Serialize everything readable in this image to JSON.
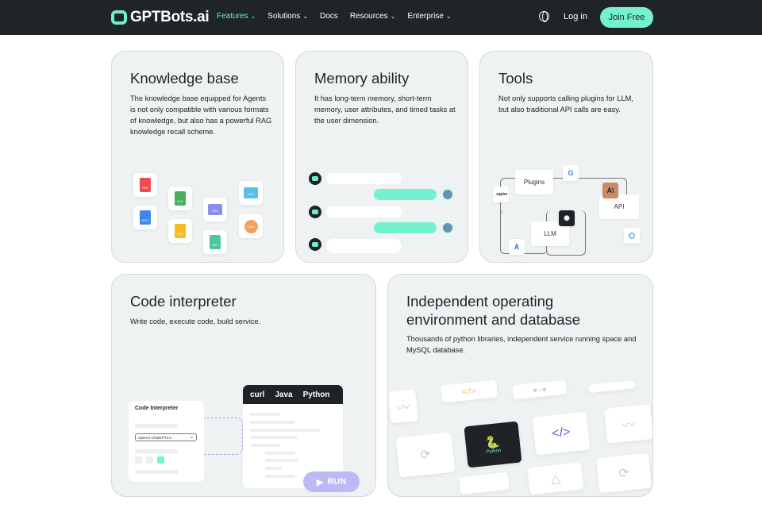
{
  "nav": {
    "brand": "GPTBots.ai",
    "items": [
      "Features",
      "Solutions",
      "Docs",
      "Resources",
      "Enterprise"
    ],
    "dropdown": [
      true,
      true,
      false,
      true,
      true
    ],
    "login": "Log in",
    "join": "Join Free",
    "accent": "#6ef0cb"
  },
  "cards": [
    {
      "title": "Knowledge base",
      "desc": "The knowledge base equipped for Agents is not only compatible with various formats of knowledge, but also has a powerful RAG knowledge recall scheme.",
      "files": [
        "PDF",
        "DOC",
        "XLS",
        "TXT",
        "URL",
        "MD",
        "FILE",
        "Q&A"
      ]
    },
    {
      "title": "Memory ability",
      "desc": "It has long-term memory, short-term memory, user attributes, and timed tasks at the user dimension."
    },
    {
      "title": "Tools",
      "desc": "Not only supports calling plugins for LLM, but also traditional API calls are easy.",
      "nodes": {
        "plugins": "Plugins",
        "llm": "LLM",
        "api": "API",
        "zapier": "_zapier"
      }
    },
    {
      "title": "Code interpreter",
      "desc": "Write code, execute code, build service.",
      "panel_title": "Code Interpreter",
      "model": "OpenAI-ChatGPT4.0",
      "tabs": [
        "curl",
        "Java",
        "Python"
      ],
      "run": "RUN"
    },
    {
      "title": "Independent operating environment and database",
      "desc": "Thousands of python libraries, independent service running space and MySQL database.",
      "python_label": "Python"
    }
  ]
}
